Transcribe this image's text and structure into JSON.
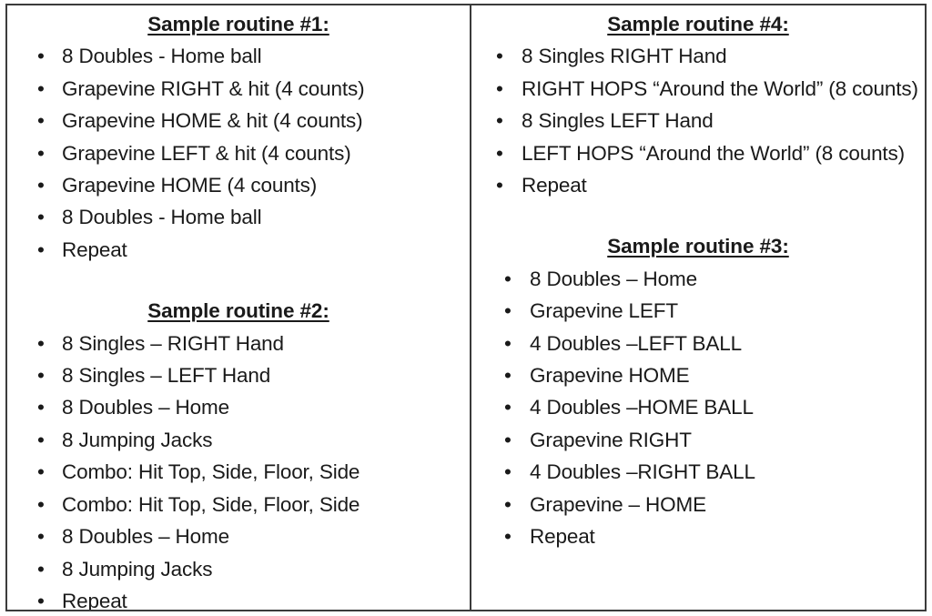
{
  "document": {
    "type": "two-column bulleted routine table",
    "columns": [
      {
        "name": "left-column",
        "routines": [
          {
            "title": "Sample routine #1:",
            "items": [
              "8 Doubles - Home ball",
              "Grapevine RIGHT & hit (4 counts)",
              "Grapevine HOME & hit (4 counts)",
              "Grapevine LEFT & hit (4 counts)",
              "Grapevine HOME (4 counts)",
              "8 Doubles - Home ball",
              "Repeat"
            ]
          },
          {
            "title": "Sample routine #2:",
            "items": [
              "8 Singles – RIGHT Hand",
              "8 Singles – LEFT Hand",
              "8 Doubles – Home",
              "8 Jumping Jacks",
              "Combo: Hit Top, Side, Floor, Side",
              "Combo: Hit Top, Side, Floor, Side",
              "8 Doubles – Home",
              "8 Jumping Jacks",
              "Repeat"
            ]
          }
        ]
      },
      {
        "name": "right-column",
        "routines": [
          {
            "title": "Sample routine #4:",
            "items": [
              "8 Singles RIGHT Hand",
              "RIGHT HOPS “Around the World” (8 counts)",
              "8 Singles LEFT Hand",
              "LEFT HOPS “Around the World” (8 counts)",
              "Repeat"
            ]
          },
          {
            "title": "Sample routine #3:",
            "items": [
              "8 Doubles – Home",
              "Grapevine LEFT",
              "4 Doubles –LEFT BALL",
              "Grapevine HOME",
              "4 Doubles –HOME BALL",
              "Grapevine RIGHT",
              "4 Doubles –RIGHT BALL",
              "Grapevine – HOME",
              "Repeat"
            ]
          }
        ]
      }
    ],
    "bullet_glyph": "•",
    "colors": {
      "text": "#1a1a1a",
      "border": "#3b3b3b",
      "background": "#ffffff"
    }
  }
}
